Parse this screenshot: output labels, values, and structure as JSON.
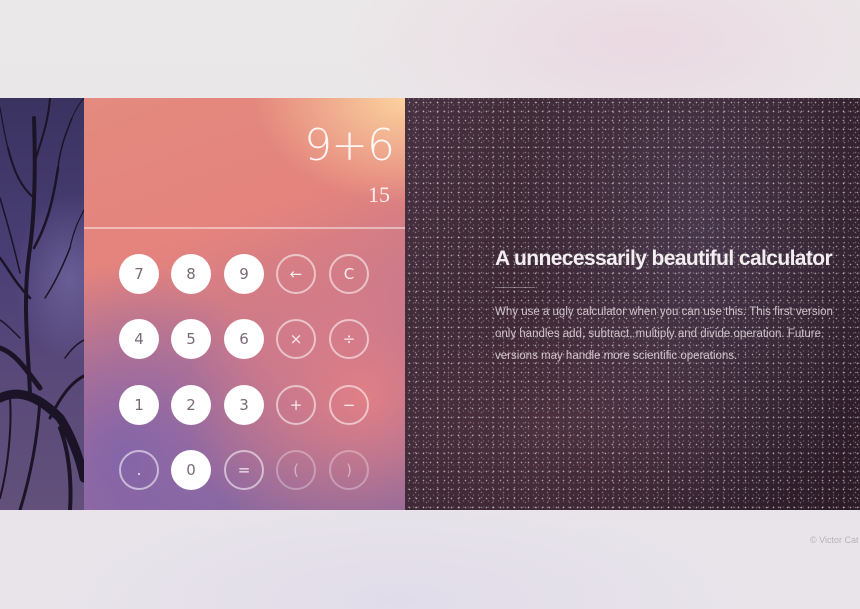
{
  "display": {
    "expression": "9+6",
    "result": "15"
  },
  "keypad": {
    "rows": [
      [
        {
          "label": "7",
          "name": "key-7",
          "style": "solid"
        },
        {
          "label": "8",
          "name": "key-8",
          "style": "solid"
        },
        {
          "label": "9",
          "name": "key-9",
          "style": "solid"
        },
        {
          "label": "←",
          "name": "backspace-icon",
          "style": "outline"
        },
        {
          "label": "C",
          "name": "clear-button",
          "style": "outline"
        }
      ],
      [
        {
          "label": "4",
          "name": "key-4",
          "style": "solid"
        },
        {
          "label": "5",
          "name": "key-5",
          "style": "solid"
        },
        {
          "label": "6",
          "name": "key-6",
          "style": "solid"
        },
        {
          "label": "×",
          "name": "multiply-button",
          "style": "outline"
        },
        {
          "label": "÷",
          "name": "divide-button",
          "style": "outline"
        }
      ],
      [
        {
          "label": "1",
          "name": "key-1",
          "style": "solid"
        },
        {
          "label": "2",
          "name": "key-2",
          "style": "solid"
        },
        {
          "label": "3",
          "name": "key-3",
          "style": "solid"
        },
        {
          "label": "+",
          "name": "add-button",
          "style": "outline"
        },
        {
          "label": "−",
          "name": "subtract-button",
          "style": "outline"
        }
      ],
      [
        {
          "label": ".",
          "name": "decimal-button",
          "style": "outline"
        },
        {
          "label": "0",
          "name": "key-0",
          "style": "solid"
        },
        {
          "label": "=",
          "name": "equals-button",
          "style": "outline"
        },
        {
          "label": "(",
          "name": "open-paren-button",
          "style": "faint"
        },
        {
          "label": ")",
          "name": "close-paren-button",
          "style": "faint"
        }
      ]
    ]
  },
  "info": {
    "title": "A unnecessarily beautiful calculator",
    "description": "Why use a ugly calculator when you can use this. This first version only handles add, subtract, multiply and divide operation. Future versions may handle more scientific operations."
  },
  "footer": {
    "credit": "© Victor Cat"
  }
}
